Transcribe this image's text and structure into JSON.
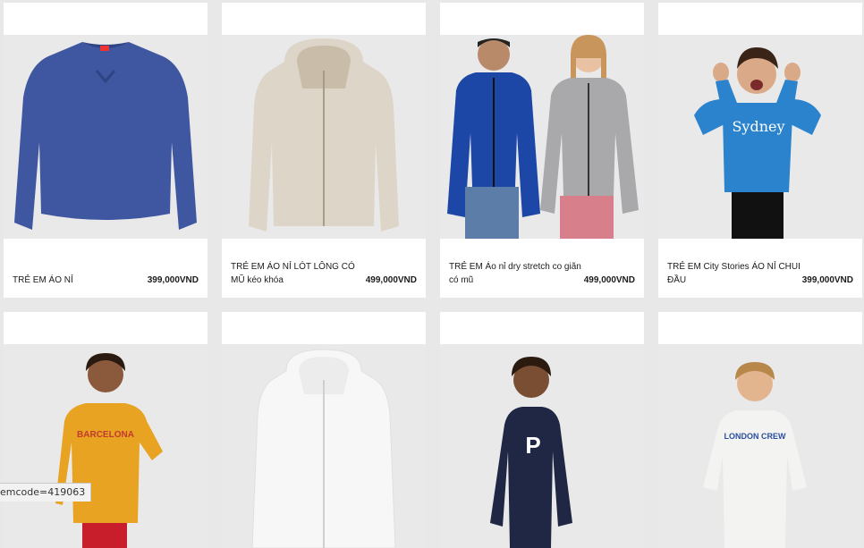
{
  "products": [
    {
      "name": "TRẺ EM ÁO NỈ",
      "price": "399,000VND",
      "image": "navy-crewneck-sweatshirt"
    },
    {
      "name": "TRẺ EM ÁO NỈ LÓT LÔNG CÓ MŨ kéo khóa",
      "price": "499,000VND",
      "image": "beige-fleece-zip-hoodie"
    },
    {
      "name": "TRẺ EM Áo nỉ dry stretch co giãn có mũ",
      "price": "499,000VND",
      "image": "two-kids-zip-hoodies"
    },
    {
      "name": "TRẺ EM City Stories ÁO NỈ CHUI ĐẦU",
      "price": "399,000VND",
      "image": "kid-blue-sydney-sweatshirt",
      "print": "Sydney"
    },
    {
      "name": "",
      "price": "",
      "image": "kid-yellow-barcelona-sweatshirt",
      "print": "BARCELONA"
    },
    {
      "name": "",
      "price": "",
      "image": "white-fleece-zip-hoodie"
    },
    {
      "name": "",
      "price": "",
      "image": "kid-navy-p-sweatshirt",
      "print": "P"
    },
    {
      "name": "",
      "price": "",
      "image": "kid-white-london-crew-sweatshirt",
      "print": "LONDON CREW"
    }
  ],
  "status_bar": {
    "text": "emcode=419063"
  },
  "colors": {
    "page_bg": "#e8e8e8",
    "card_bg": "#ffffff",
    "image_bg": "#e9e9e9"
  }
}
